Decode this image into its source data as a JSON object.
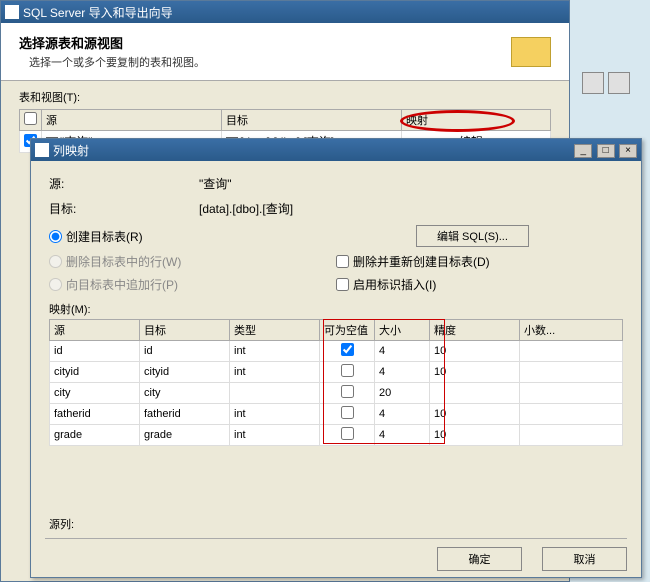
{
  "wizard": {
    "title": "SQL Server 导入和导出向导",
    "header_title": "选择源表和源视图",
    "header_subtitle": "选择一个或多个要复制的表和视图。",
    "tables_label": "表和视图(T):",
    "columns": {
      "source": "源",
      "target": "目标",
      "mapping": "映射"
    },
    "row": {
      "source": "\"查询\"",
      "target": "[data].[dbo].[查询]",
      "mapping": "编辑..."
    }
  },
  "dialog": {
    "title": "列映射",
    "source_label": "源:",
    "source_value": "\"查询\"",
    "target_label": "目标:",
    "target_value": "[data].[dbo].[查询]",
    "edit_sql_btn": "编辑 SQL(S)...",
    "opt_create": "创建目标表(R)",
    "opt_delete_rows": "删除目标表中的行(W)",
    "opt_append": "向目标表中追加行(P)",
    "opt_drop_recreate": "删除并重新创建目标表(D)",
    "opt_identity": "启用标识插入(I)",
    "mapping_label": "映射(M):",
    "cols": {
      "source": "源",
      "target": "目标",
      "type": "类型",
      "nullable": "可为空值",
      "size": "大小",
      "precision": "精度",
      "scale": "小数..."
    },
    "rows": [
      {
        "source": "id",
        "target": "id",
        "type": "int",
        "nullable": true,
        "size": "4",
        "precision": "10",
        "scale": ""
      },
      {
        "source": "cityid",
        "target": "cityid",
        "type": "int",
        "nullable": false,
        "size": "4",
        "precision": "10",
        "scale": ""
      },
      {
        "source": "city",
        "target": "city",
        "type": "",
        "nullable": false,
        "size": "20",
        "precision": "",
        "scale": ""
      },
      {
        "source": "fatherid",
        "target": "fatherid",
        "type": "int",
        "nullable": false,
        "size": "4",
        "precision": "10",
        "scale": ""
      },
      {
        "source": "grade",
        "target": "grade",
        "type": "int",
        "nullable": false,
        "size": "4",
        "precision": "10",
        "scale": ""
      }
    ],
    "source_col_label": "源列:",
    "ok_btn": "确定",
    "cancel_btn": "取消"
  }
}
